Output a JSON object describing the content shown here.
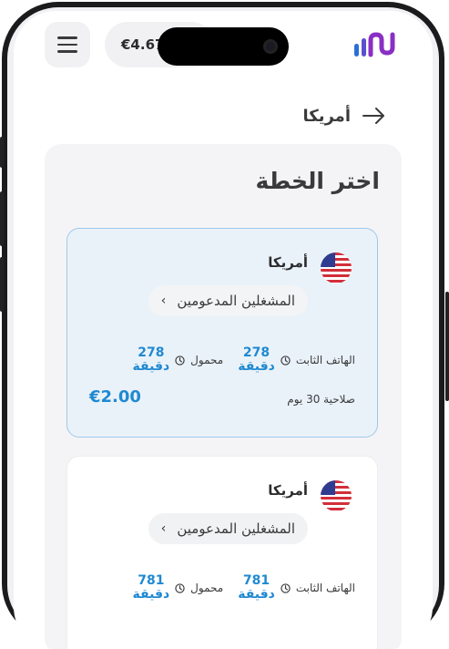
{
  "status": {
    "balance": "€4.67"
  },
  "header": {
    "back_title": "أمريكا"
  },
  "plan_panel": {
    "title": "اختر الخطة"
  },
  "plans": [
    {
      "country": "أمريكا",
      "operators_label": "المشغلين المدعومين",
      "landline_label": "الهاتف الثابت",
      "landline_value": "278",
      "mobile_label": "محمول",
      "mobile_value": "278",
      "minutes_unit": "دقيقة",
      "validity": "صلاحية 30 يوم",
      "price": "€2.00",
      "selected": true
    },
    {
      "country": "أمريكا",
      "operators_label": "المشغلين المدعومين",
      "landline_label": "الهاتف الثابت",
      "landline_value": "781",
      "mobile_label": "محمول",
      "mobile_value": "781",
      "minutes_unit": "دقيقة",
      "selected": false
    }
  ],
  "colors": {
    "accent": "#1f89d2",
    "selected_bg": "#eaf2f9",
    "selected_border": "#9fc8ea",
    "logo_purple": "#7b2fbe",
    "logo_blue": "#2b6fd6"
  }
}
